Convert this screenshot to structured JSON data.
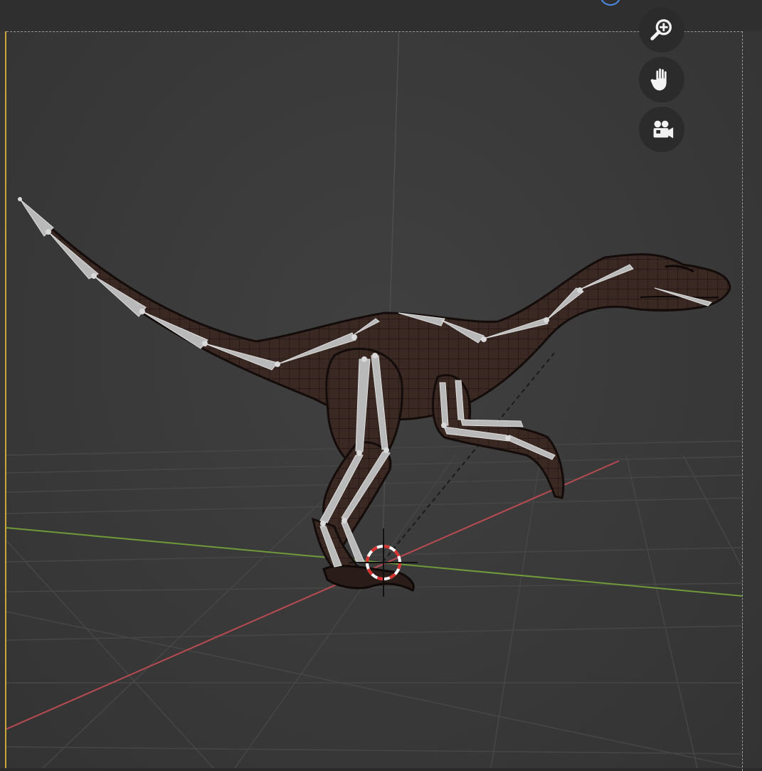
{
  "viewport": {
    "mode": "3D viewport",
    "axis_colors": {
      "x": "#b94a52",
      "y": "#6f9a3a",
      "z": "#5a5a5a"
    },
    "grid_color": "#464646",
    "background_color": "#393939"
  },
  "model": {
    "skin_color": "#3a2823",
    "bone_color": "#b9b9b9",
    "wire_color": "#1b1210"
  },
  "nav_gizmo": {
    "buttons": [
      {
        "icon": "zoom-icon"
      },
      {
        "icon": "hand-pan-icon"
      },
      {
        "icon": "camera-icon"
      }
    ]
  },
  "cursor_3d": {
    "icon": "3d-cursor-icon",
    "colors": [
      "#d9322e",
      "#ffffff"
    ]
  }
}
